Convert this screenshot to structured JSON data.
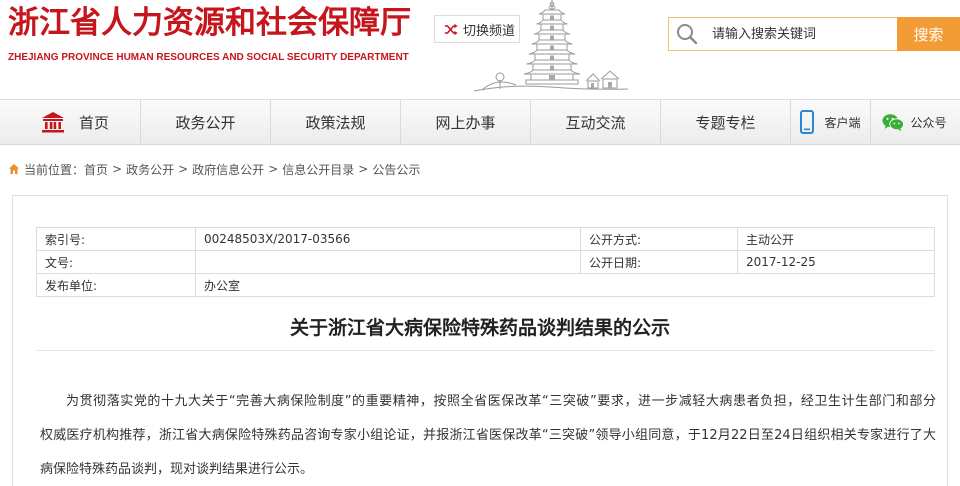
{
  "colors": {
    "brand_red": "#c4161c",
    "search_orange": "#f39b34",
    "search_border": "#f6bd73",
    "client_blue": "#2b86d3",
    "wechat_green": "#3bb034",
    "breadcrumb_icon": "#e8912c"
  },
  "header": {
    "logo_cn": "浙江省人力资源和社会保障厅",
    "logo_en": "ZHEJIANG PROVINCE HUMAN RESOURCES AND SOCIAL SECURITY DEPARTMENT",
    "switch_channel": {
      "icon": "shuffle-icon",
      "label": "切换频道"
    },
    "search": {
      "icon": "search-icon",
      "placeholder": "请输入搜索关键词",
      "value": "",
      "button_label": "搜索"
    }
  },
  "nav": {
    "items": [
      {
        "label": "首页",
        "icon": "home-icon"
      },
      {
        "label": "政务公开"
      },
      {
        "label": "政策法规"
      },
      {
        "label": "网上办事"
      },
      {
        "label": "互动交流"
      },
      {
        "label": "专题专栏"
      },
      {
        "label": "客户端",
        "icon": "mobile-phone-icon"
      },
      {
        "label": "公众号",
        "icon": "wechat-icon"
      }
    ]
  },
  "breadcrumb": {
    "icon": "home-icon",
    "prefix": "当前位置：",
    "separator": ">",
    "items": [
      "首页",
      "政务公开",
      "政府信息公开",
      "信息公开目录",
      "公告公示"
    ]
  },
  "article": {
    "meta": {
      "rows": [
        [
          {
            "label": "索引号:",
            "value": "00248503X/2017-03566"
          },
          {
            "label": "公开方式:",
            "value": "主动公开"
          }
        ],
        [
          {
            "label": "文号:",
            "value": ""
          },
          {
            "label": "公开日期:",
            "value": "2017-12-25"
          }
        ],
        [
          {
            "label": "发布单位:",
            "value": "办公室"
          }
        ]
      ]
    },
    "title": "关于浙江省大病保险特殊药品谈判结果的公示",
    "body_lines": [
      "为贯彻落实党的十九大关于“完善大病保险制度”的重要精神，按照全省医保改革“三突破”要求，进一步减轻大病患者负担，经卫生计生部门和部分",
      "权威医疗机构推荐，浙江省大病保险特殊药品咨询专家小组论证，并报浙江省医保改革“三突破”领导小组同意，于12月22日至24日组织相关专家进行了大",
      "病保险特殊药品谈判，现对谈判结果进行公示。"
    ]
  }
}
